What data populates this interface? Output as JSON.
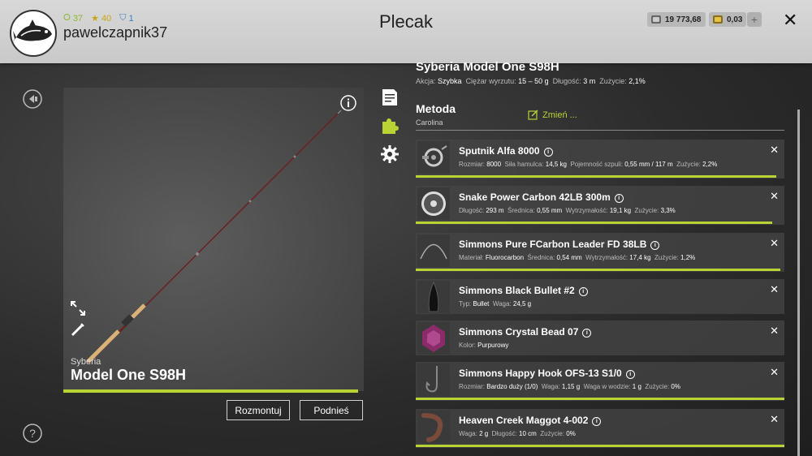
{
  "header": {
    "title": "Plecak",
    "username": "pawelczapnik37",
    "stats": {
      "level": "37",
      "stars": "40",
      "pass": "1"
    },
    "silver": "19 773,68",
    "gold": "0,03",
    "plus": "+",
    "close": "✕"
  },
  "rod": {
    "brand": "Syberia",
    "name": "Model One S98H",
    "buttons": {
      "dismount": "Rozmontuj",
      "pickup": "Podnieś"
    }
  },
  "detail": {
    "name": "Syberia Model One S98H",
    "props": [
      {
        "k": "Akcja:",
        "v": "Szybka"
      },
      {
        "k": "Ciężar wyrzutu:",
        "v": "15 – 50 g"
      },
      {
        "k": "Długość:",
        "v": "3 m"
      },
      {
        "k": "Zużycie:",
        "v": "2,1%"
      }
    ],
    "method_label": "Metoda",
    "method_value": "Carolina",
    "change_label": "Zmień ..."
  },
  "items": [
    {
      "name": "Sputnik Alfa 8000",
      "props": [
        {
          "k": "Rozmiar:",
          "v": "8000"
        },
        {
          "k": "Siła hamulca:",
          "v": "14,5 kg"
        },
        {
          "k": "Pojemność szpuli:",
          "v": "0,55 mm / 117 m"
        },
        {
          "k": "Zużycie:",
          "v": "2,2%"
        }
      ],
      "icon": "reel-icon",
      "condition": 0.978
    },
    {
      "name": "Snake Power Carbon 42LB 300m",
      "props": [
        {
          "k": "Długość:",
          "v": "293 m"
        },
        {
          "k": "Średnica:",
          "v": "0,55 mm"
        },
        {
          "k": "Wytrzymałość:",
          "v": "19,1 kg"
        },
        {
          "k": "Zużycie:",
          "v": "3,3%"
        }
      ],
      "icon": "line-spool-icon",
      "condition": 0.967
    },
    {
      "name": "Simmons Pure FCarbon Leader FD 38LB",
      "props": [
        {
          "k": "Materiał:",
          "v": "Fluorocarbon"
        },
        {
          "k": "Średnica:",
          "v": "0,54 mm"
        },
        {
          "k": "Wytrzymałość:",
          "v": "17,4 kg"
        },
        {
          "k": "Zużycie:",
          "v": "1,2%"
        }
      ],
      "icon": "leader-icon",
      "condition": 0.988
    },
    {
      "name": "Simmons Black Bullet #2",
      "props": [
        {
          "k": "Typ:",
          "v": "Bullet"
        },
        {
          "k": "Waga:",
          "v": "24,5 g"
        }
      ],
      "icon": "bullet-sinker-icon",
      "condition": 1.0
    },
    {
      "name": "Simmons Crystal Bead 07",
      "props": [
        {
          "k": "Kolor:",
          "v": "Purpurowy"
        }
      ],
      "icon": "bead-icon",
      "condition": 1.0
    },
    {
      "name": "Simmons Happy Hook OFS-13 S1/0",
      "props": [
        {
          "k": "Rozmiar:",
          "v": "Bardzo duży (1/0)"
        },
        {
          "k": "Waga:",
          "v": "1,15 g"
        },
        {
          "k": "Waga w wodzie:",
          "v": "1 g"
        },
        {
          "k": "Zużycie:",
          "v": "0%"
        }
      ],
      "icon": "hook-icon",
      "condition": 1.0
    },
    {
      "name": "Heaven Creek Maggot 4-002",
      "props": [
        {
          "k": "Waga:",
          "v": "2 g"
        },
        {
          "k": "Długość:",
          "v": "10 cm"
        },
        {
          "k": "Zużycie:",
          "v": "0%"
        }
      ],
      "icon": "maggot-bait-icon",
      "condition": 1.0
    }
  ],
  "colors": {
    "accent": "#b8d434",
    "topbar": "#d0d0d0"
  }
}
